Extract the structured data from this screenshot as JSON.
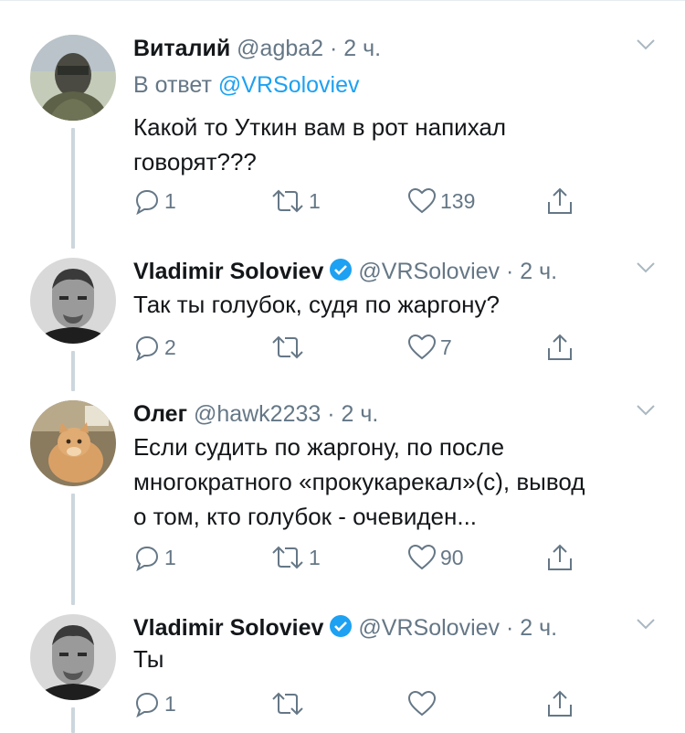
{
  "tweets": [
    {
      "name": "Виталий",
      "handle": "@agba2",
      "separator": "·",
      "time": "2 ч.",
      "reply_prefix": "В ответ",
      "reply_handle": "@VRSoloviev",
      "lines": [
        "Какой то Уткин вам в рот напихал",
        "говорят???"
      ],
      "replies": "1",
      "retweets": "1",
      "likes": "139"
    },
    {
      "name": "Vladimir Soloviev",
      "verified": true,
      "handle": "@VRSoloviev",
      "separator": "·",
      "time": "2 ч.",
      "lines": [
        "Так ты голубок, судя по жаргону?"
      ],
      "replies": "2",
      "retweets": "",
      "likes": "7"
    },
    {
      "name": "Олег",
      "handle": "@hawk2233",
      "separator": "·",
      "time": "2 ч.",
      "lines": [
        "Если судить по жаргону, по после",
        "многократного «прокукарекал»(с), вывод",
        "о том, кто голубок - очевиден..."
      ],
      "replies": "1",
      "retweets": "1",
      "likes": "90"
    },
    {
      "name": "Vladimir Soloviev",
      "verified": true,
      "handle": "@VRSoloviev",
      "separator": "·",
      "time": "2 ч.",
      "lines": [
        "Ты"
      ],
      "replies": "1",
      "retweets": "",
      "likes": ""
    }
  ],
  "icons": {
    "reply": "reply-icon",
    "retweet": "retweet-icon",
    "like": "heart-icon",
    "share": "share-icon",
    "more": "chevron-down-icon",
    "verified": "verified-badge-icon"
  },
  "colors": {
    "text": "#14171a",
    "secondary": "#657786",
    "link": "#1da1f2",
    "verified": "#1da1f2",
    "thread_line": "#ccd6dd"
  }
}
